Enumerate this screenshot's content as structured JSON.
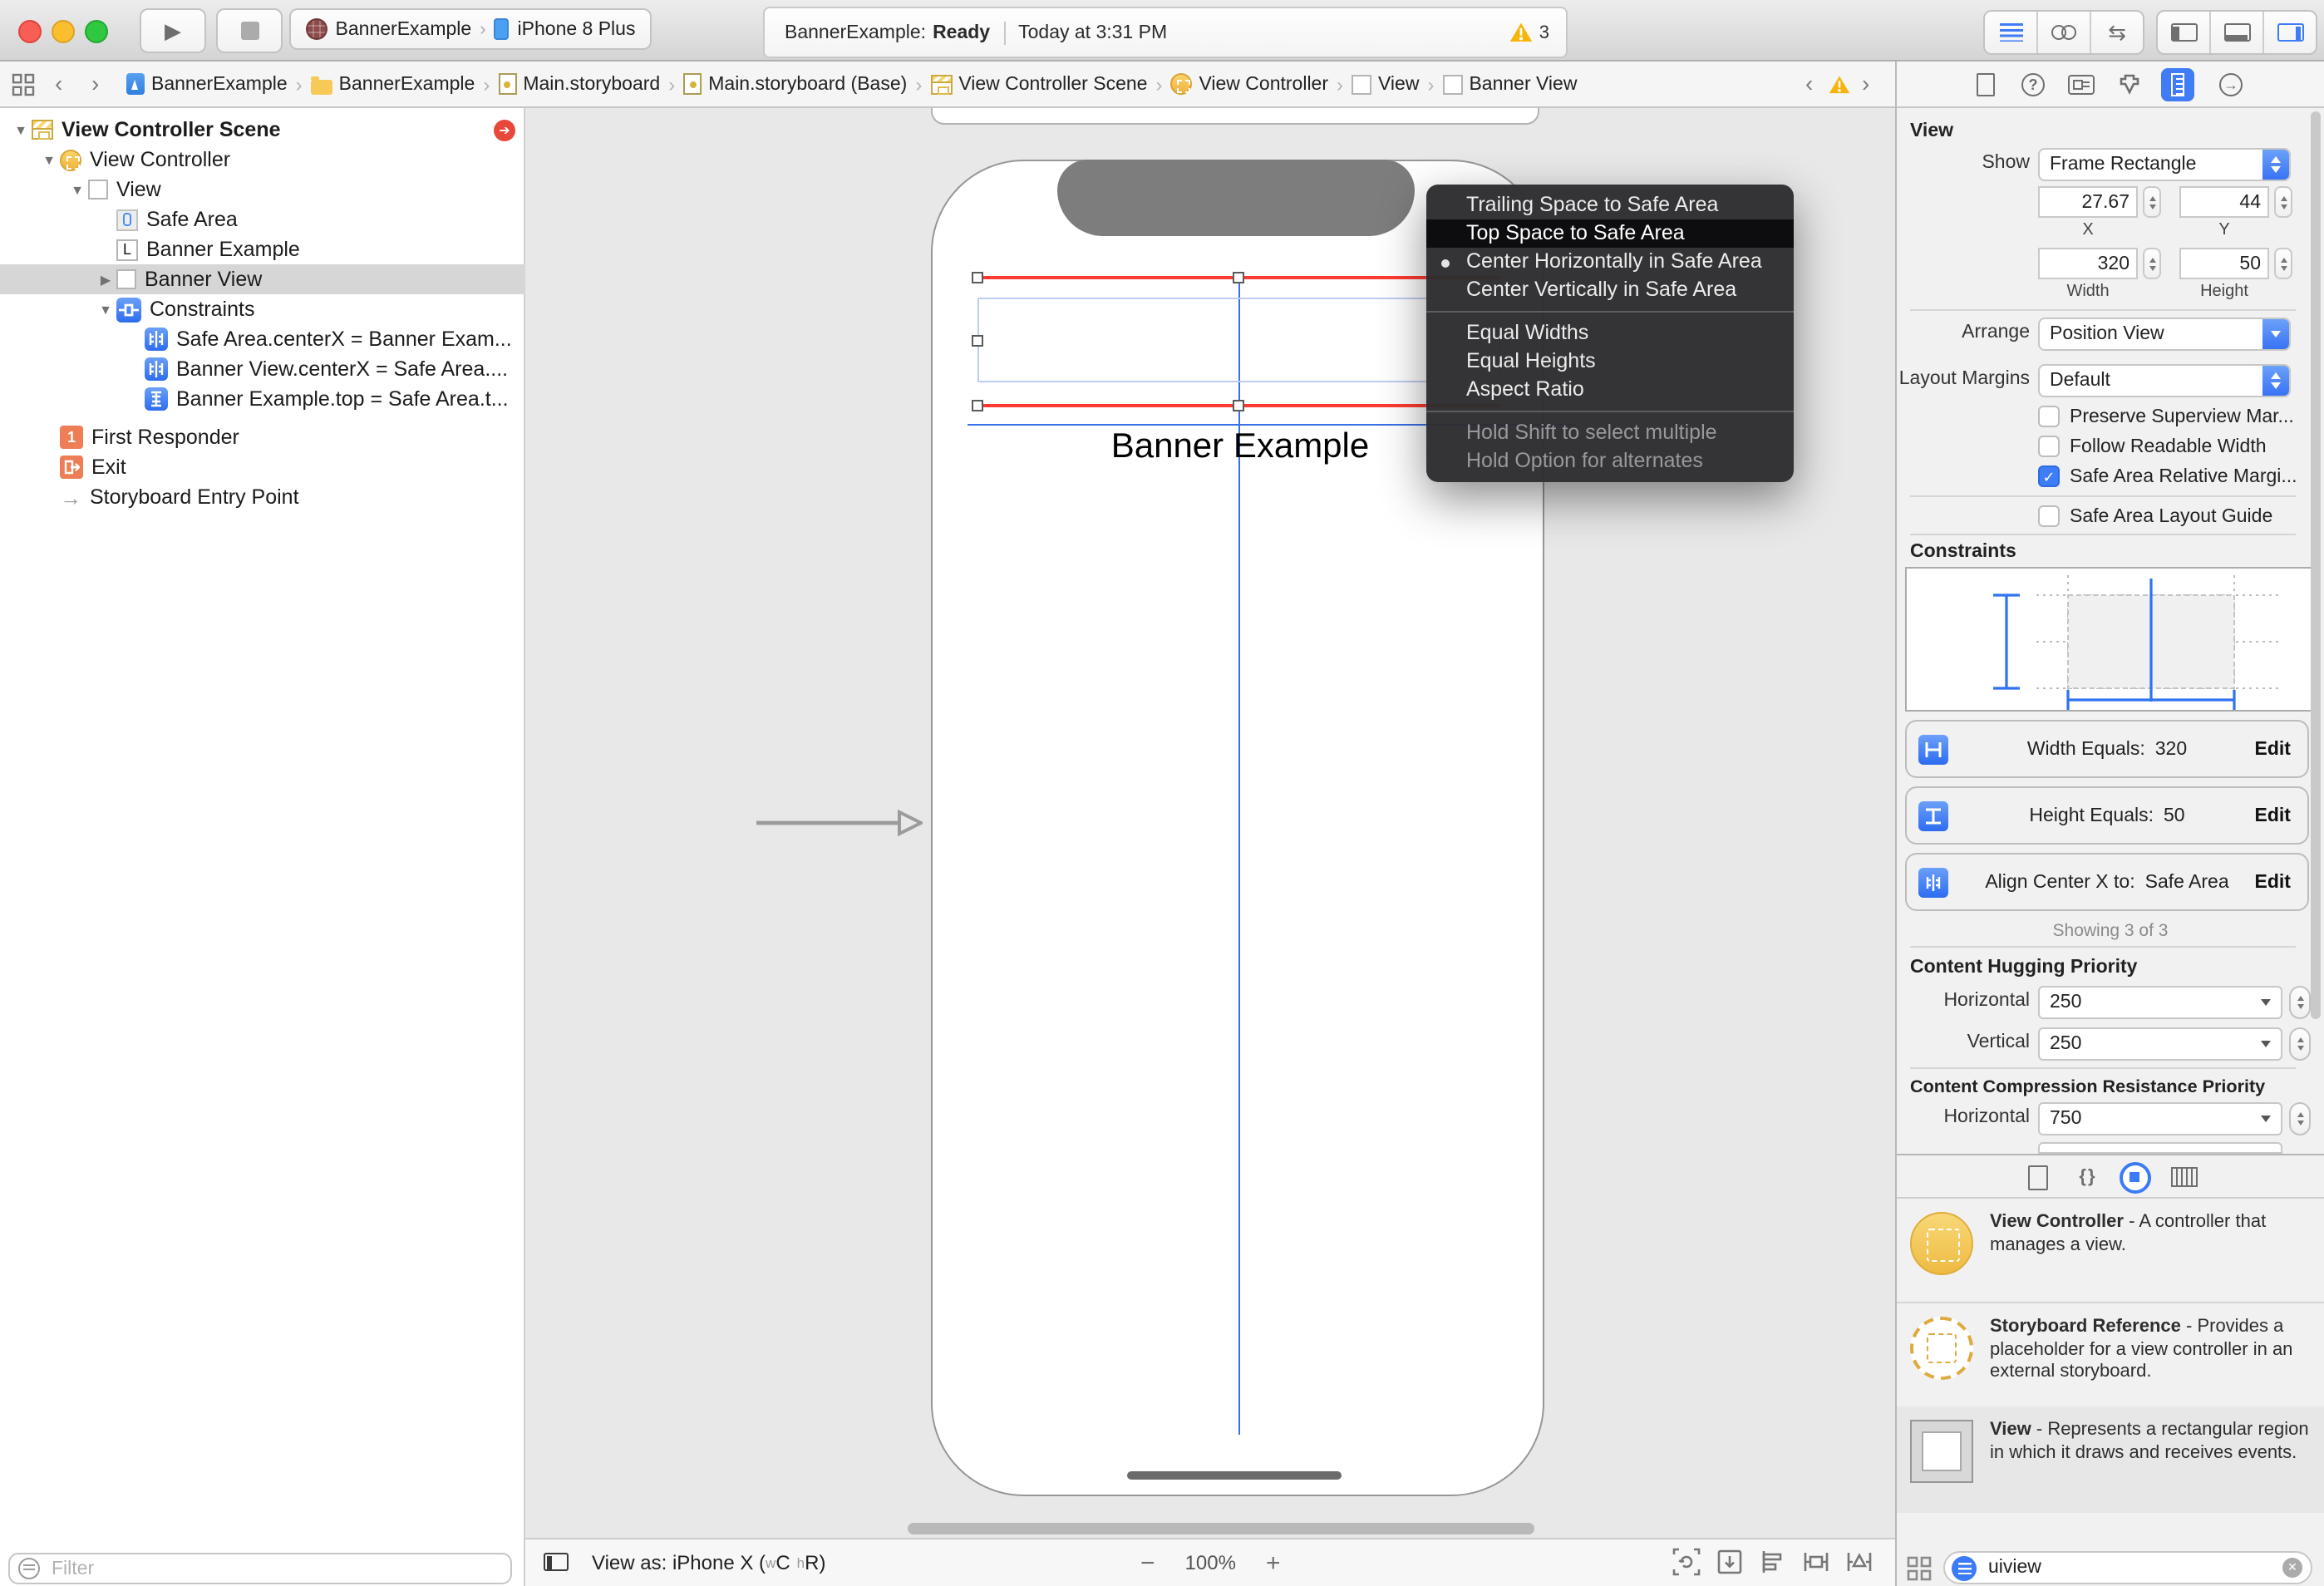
{
  "toolbar": {
    "scheme_project": "BannerExample",
    "scheme_device": "iPhone 8 Plus",
    "status_project": "BannerExample:",
    "status_state": "Ready",
    "status_time": "Today at 3:31 PM",
    "warning_count": "3"
  },
  "jumpbar": {
    "crumbs": [
      {
        "label": "BannerExample",
        "icon": "project-file-icon"
      },
      {
        "label": "BannerExample",
        "icon": "folder-icon"
      },
      {
        "label": "Main.storyboard",
        "icon": "storyboard-file-icon"
      },
      {
        "label": "Main.storyboard (Base)",
        "icon": "storyboard-file-icon"
      },
      {
        "label": "View Controller Scene",
        "icon": "scene-icon"
      },
      {
        "label": "View Controller",
        "icon": "view-controller-icon"
      },
      {
        "label": "View",
        "icon": "view-icon"
      },
      {
        "label": "Banner View",
        "icon": "view-icon"
      }
    ]
  },
  "outline": {
    "rows": [
      {
        "disclosure": "▼",
        "label": "View Controller Scene",
        "icon": "scene-icon",
        "level": 0,
        "bold": true,
        "badge": true
      },
      {
        "disclosure": "▼",
        "label": "View Controller",
        "icon": "view-controller-icon",
        "level": 1
      },
      {
        "disclosure": "▼",
        "label": "View",
        "icon": "view-icon",
        "level": 2
      },
      {
        "disclosure": "",
        "label": "Safe Area",
        "icon": "safe-area-icon",
        "level": 3
      },
      {
        "disclosure": "",
        "label": "Banner Example",
        "icon": "label-icon",
        "level": 3
      },
      {
        "disclosure": "▶",
        "label": "Banner View",
        "icon": "view-icon",
        "level": 3,
        "selected": true
      },
      {
        "disclosure": "▼",
        "label": "Constraints",
        "icon": "constraints-icon",
        "level": 3
      },
      {
        "disclosure": "",
        "label": "Safe Area.centerX = Banner Exam...",
        "icon": "align-constraint-icon",
        "level": 4
      },
      {
        "disclosure": "",
        "label": "Banner View.centerX = Safe Area....",
        "icon": "align-constraint-icon",
        "level": 4
      },
      {
        "disclosure": "",
        "label": "Banner Example.top = Safe Area.t...",
        "icon": "vertical-constraint-icon",
        "level": 4
      },
      {
        "disclosure": "",
        "label": "First Responder",
        "icon": "first-responder-icon",
        "level": 1
      },
      {
        "disclosure": "",
        "label": "Exit",
        "icon": "exit-icon",
        "level": 1
      },
      {
        "disclosure": "",
        "label": "Storyboard Entry Point",
        "icon": "entry-point-icon",
        "level": 1
      }
    ],
    "filter_placeholder": "Filter"
  },
  "canvas": {
    "banner_label": "Banner Example",
    "device_bar": {
      "prefix": "View as: iPhone X (",
      "w": "w",
      "c": "C",
      "h": "h",
      "r": "R",
      "suffix": ")",
      "zoom": "100%"
    }
  },
  "menu": {
    "items": [
      {
        "label": "Trailing Space to Safe Area",
        "state": "normal"
      },
      {
        "label": "Top Space to Safe Area",
        "state": "highlighted"
      },
      {
        "label": "Center Horizontally in Safe Area",
        "state": "bulleted"
      },
      {
        "label": "Center Vertically in Safe Area",
        "state": "normal"
      },
      {
        "label": "Equal Widths",
        "state": "normal"
      },
      {
        "label": "Equal Heights",
        "state": "normal"
      },
      {
        "label": "Aspect Ratio",
        "state": "normal"
      },
      {
        "label": "Hold Shift to select multiple",
        "state": "disabled"
      },
      {
        "label": "Hold Option for alternates",
        "state": "disabled"
      }
    ]
  },
  "inspector": {
    "title": "View",
    "show_label": "Show",
    "show_value": "Frame Rectangle",
    "x_value": "27.67",
    "x_label": "X",
    "y_value": "44",
    "y_label": "Y",
    "width_value": "320",
    "width_label": "Width",
    "height_value": "50",
    "height_label": "Height",
    "arrange_label": "Arrange",
    "arrange_value": "Position View",
    "layout_margins_label": "Layout Margins",
    "layout_margins_value": "Default",
    "checkbox_preserve": "Preserve Superview Mar...",
    "checkbox_readable": "Follow Readable Width",
    "checkbox_safe_margins": "Safe Area Relative Margi...",
    "checkbox_safe_guide": "Safe Area Layout Guide",
    "constraints_title": "Constraints",
    "constraint_rows": [
      {
        "label": "Width Equals:",
        "value": "320",
        "action": "Edit",
        "icon": "width-constraint-icon"
      },
      {
        "label": "Height Equals:",
        "value": "50",
        "action": "Edit",
        "icon": "height-constraint-icon"
      },
      {
        "label": "Align Center X to:",
        "value": "Safe Area",
        "action": "Edit",
        "icon": "align-constraint-icon"
      }
    ],
    "showing": "Showing 3 of 3",
    "hugging_title": "Content Hugging Priority",
    "hugging_horizontal_label": "Horizontal",
    "hugging_horizontal_value": "250",
    "hugging_vertical_label": "Vertical",
    "hugging_vertical_value": "250",
    "compression_title": "Content Compression Resistance Priority",
    "compression_horizontal_label": "Horizontal",
    "compression_horizontal_value": "750"
  },
  "library": {
    "items": [
      {
        "title": "View Controller",
        "desc": "- A controller that manages a view.",
        "icon": "view-controller-library-icon"
      },
      {
        "title": "Storyboard Reference",
        "desc": "- Provides a placeholder for a view controller in an external storyboard.",
        "icon": "storyboard-reference-library-icon"
      },
      {
        "title": "View",
        "desc": "- Represents a rectangular region in which it draws and receives events.",
        "icon": "view-library-icon",
        "selected": true
      }
    ],
    "filter_value": "uiview"
  },
  "glyphs": {
    "play": "▶",
    "crumb_sep": "›",
    "back": "‹",
    "forward": "›",
    "question": "?",
    "connect_arrow": "→",
    "entry_arrow": "→",
    "label_letter": "L",
    "responder_one": "1",
    "badge_arrow": "➔",
    "check": "✓",
    "minus": "−",
    "plus": "+",
    "clear": "✕",
    "braces": "{ }",
    "swap_arrows": "⇆"
  }
}
